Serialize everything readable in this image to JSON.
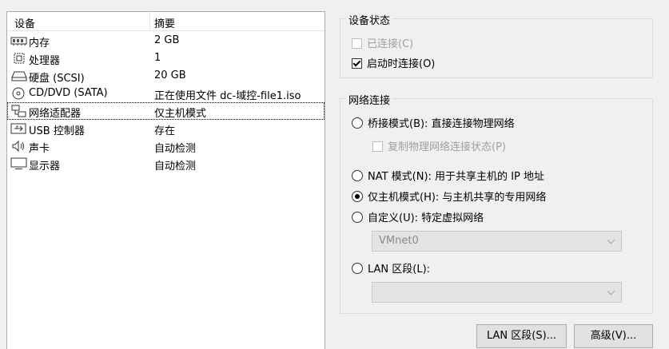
{
  "device_list": {
    "headers": {
      "device": "设备",
      "summary": "摘要"
    },
    "rows": [
      {
        "icon": "memory-icon",
        "name": "内存",
        "summary": "2 GB"
      },
      {
        "icon": "cpu-icon",
        "name": "处理器",
        "summary": "1"
      },
      {
        "icon": "harddisk-icon",
        "name": "硬盘 (SCSI)",
        "summary": "20 GB"
      },
      {
        "icon": "cd-dvd-icon",
        "name": "CD/DVD (SATA)",
        "summary": "正在使用文件 dc-域控-file1.iso"
      },
      {
        "icon": "network-adapter-icon",
        "name": "网络适配器",
        "summary": "仅主机模式",
        "selected": true
      },
      {
        "icon": "usb-icon",
        "name": "USB 控制器",
        "summary": "存在"
      },
      {
        "icon": "sound-icon",
        "name": "声卡",
        "summary": "自动检测"
      },
      {
        "icon": "display-icon",
        "name": "显示器",
        "summary": "自动检测"
      }
    ]
  },
  "device_status": {
    "title": "设备状态",
    "connected": {
      "label": "已连接(C)",
      "checked": false,
      "enabled": false
    },
    "connect_at_power_on": {
      "label": "启动时连接(O)",
      "checked": true,
      "enabled": true
    }
  },
  "network_connection": {
    "title": "网络连接",
    "bridged": {
      "label": "桥接模式(B): 直接连接物理网络",
      "selected": false
    },
    "replicate": {
      "label": "复制物理网络连接状态(P)",
      "checked": false,
      "enabled": false
    },
    "nat": {
      "label": "NAT 模式(N): 用于共享主机的 IP 地址",
      "selected": false
    },
    "host_only": {
      "label": "仅主机模式(H): 与主机共享的专用网络",
      "selected": true
    },
    "custom": {
      "label": "自定义(U): 特定虚拟网络",
      "selected": false
    },
    "custom_select": {
      "value": "VMnet0"
    },
    "lan_segment": {
      "label": "LAN 区段(L):",
      "selected": false
    },
    "lan_select": {
      "value": ""
    }
  },
  "buttons": {
    "lan_segments": "LAN 区段(S)...",
    "advanced": "高级(V)..."
  }
}
